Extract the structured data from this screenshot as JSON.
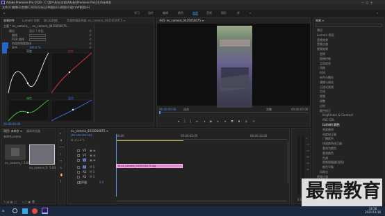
{
  "window": {
    "title": "Adobe Premiere Pro 2020 - C:\\用户\\Edu\\文档\\Adobe\\Premiere Pro\\14.0\\未命名",
    "menu": [
      "文件(F)",
      "编辑(E)",
      "剪辑(C)",
      "序列(S)",
      "标记(M)",
      "图形(G)",
      "视图(V)",
      "窗口(W)",
      "帮助(H)"
    ]
  },
  "workspaces": [
    "学习",
    "组件",
    "编辑",
    "颜色",
    "效果",
    "音频",
    "图形",
    "库"
  ],
  "effect_controls": {
    "tabs": [
      "效果控件",
      "Lumetri 范围",
      "源:(无剪辑)",
      "音频剪辑混合器: ev_camera_0435050075 ≡"
    ],
    "header": "主要 * ev_camera_...  ev_camera_0435050075...",
    "curve_labels": [
      "亮度",
      "红色",
      "绿色",
      "蓝色"
    ],
    "items": [
      "输出",
      "显示 ? 对比",
      "曲线",
      "RGB 曲线",
      "色相饱和度曲线",
      "复合",
      "100.0 %"
    ],
    "time": "00:00:00:00"
  },
  "program": {
    "tab": "节目: ev_camera_0435050075 ≡",
    "timecode_left": "00:00:00:00",
    "fit": "适合",
    "quality": "完整",
    "timecode_right": "00:00:05:00"
  },
  "effects": {
    "title": "效果 ≡",
    "items": [
      "预设",
      "Lumetri 预设",
      "音频效果",
      "音频过渡",
      "视频效果",
      "变换",
      "图像控制",
      "实用程序",
      "扭曲",
      "时间",
      "杂色与颗粒",
      "模糊与锐化",
      "沉浸式视频",
      "生成",
      "视频",
      "调整",
      "过时",
      "颜色校正",
      "Brightness & Contrast",
      "ASC CDL",
      "Lumetri 颜色",
      "亮度曲线",
      "亮度校正器",
      "广播颜色",
      "快速颜色校正器",
      "更改为颜色",
      "更改颜色",
      "色调",
      "视频限幅器(旧版)",
      "颜色平衡",
      "风格化",
      "视频过渡",
      "3D 运动"
    ],
    "footer": "基本图形"
  },
  "project": {
    "tabs": [
      "项目: 未命名 ≡",
      "媒体浏览器"
    ],
    "file": "未命名.prproj",
    "items": [
      {
        "name": "ev_camera_0435...",
        "dur": "5:00"
      },
      {
        "name": "ev_camera_0435050...",
        "dur": "5:00"
      }
    ]
  },
  "timeline": {
    "tab": "ev_camera_0435050075 ≡",
    "timecode": "00:00:00:00",
    "ruler": [
      "00:00",
      "00:00:05:00",
      "00:00:10:00"
    ],
    "tracks": [
      "V3",
      "V2",
      "V1",
      "A1",
      "A2",
      "A3",
      "主声道"
    ],
    "master_value": "0.0",
    "clip": "fx ev_camera_0435050075.jpg"
  },
  "watermark": "最需教育",
  "taskbar": {
    "time": "14:56",
    "date": "2021/11/16"
  }
}
